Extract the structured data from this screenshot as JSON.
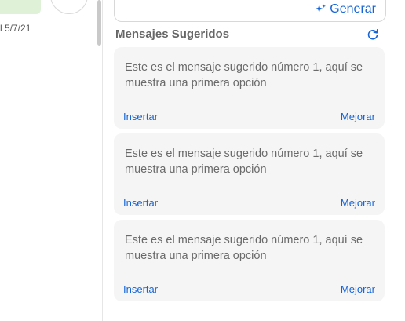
{
  "chat": {
    "date": "l 5/7/21"
  },
  "assistant": {
    "generate_label": "Generar",
    "section_title": "Mensajes Sugeridos",
    "suggestions": [
      {
        "text": "Este es el mensaje sugerido número 1, aquí se muestra una primera opción",
        "insert_label": "Insertar",
        "improve_label": "Mejorar"
      },
      {
        "text": "Este es el mensaje sugerido número 1, aquí se muestra una primera opción",
        "insert_label": "Insertar",
        "improve_label": "Mejorar"
      },
      {
        "text": "Este es el mensaje sugerido número 1, aquí se muestra una primera opción",
        "insert_label": "Insertar",
        "improve_label": "Mejorar"
      }
    ]
  },
  "icons": {
    "generate": "sparkle-icon",
    "refresh": "refresh-icon"
  },
  "colors": {
    "accent": "#1565d8",
    "bubble": "#dff2d8",
    "card": "#f5f5f5"
  }
}
